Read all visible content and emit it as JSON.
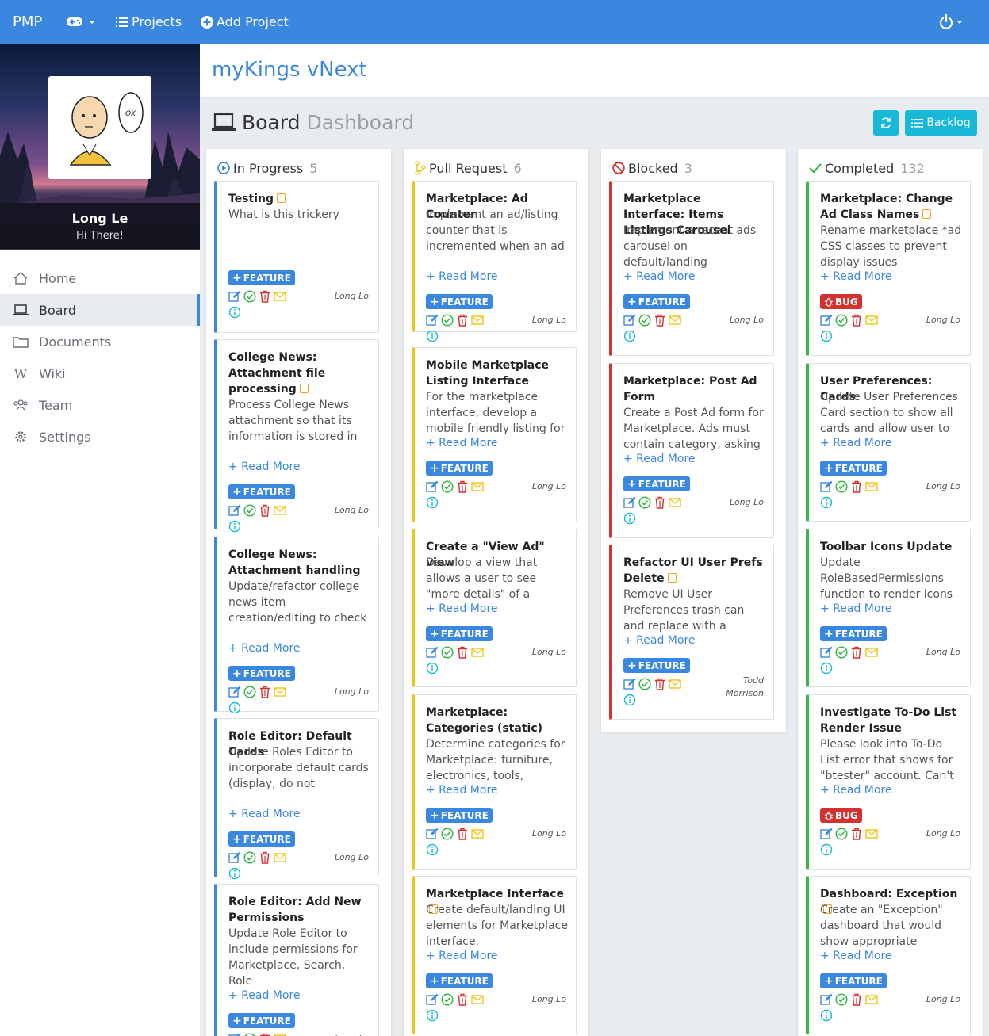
{
  "navbar": {
    "brand": "PMP",
    "projects_label": "Projects",
    "add_project_label": "Add Project"
  },
  "sidebar": {
    "user_name": "Long Le",
    "greeting": "Hi There!",
    "items": [
      {
        "label": "Home",
        "icon": "home-icon"
      },
      {
        "label": "Board",
        "icon": "laptop-icon",
        "active": true
      },
      {
        "label": "Documents",
        "icon": "folder-icon"
      },
      {
        "label": "Wiki",
        "icon": "wikipedia-icon"
      },
      {
        "label": "Team",
        "icon": "users-icon"
      },
      {
        "label": "Settings",
        "icon": "gear-icon"
      }
    ]
  },
  "page": {
    "title": "myKings vNext",
    "board_label": "Board",
    "board_sub": "Dashboard",
    "backlog_label": "Backlog"
  },
  "colors": {
    "primary": "#3a87e0",
    "info": "#17b9d6",
    "in_progress": "#3a87e0",
    "pull_request": "#f0c419",
    "blocked": "#d6302f",
    "completed": "#3bb54a"
  },
  "columns": [
    {
      "title": "In Progress",
      "count": "5",
      "cards": [
        {
          "title": "Testing",
          "desc": "What is this trickery",
          "read_more": "",
          "type": "FEATURE",
          "owner": "Long Lo"
        },
        {
          "title": "College News: Attachment file processing",
          "desc": "Process College News attachment so that its information is stored in",
          "read_more": "+ Read More",
          "type": "FEATURE",
          "owner": "Long Lo"
        },
        {
          "title": "College News: Attachment handling",
          "desc": "Update/refactor college news item creation/editing to check",
          "read_more": "+ Read More",
          "type": "FEATURE",
          "owner": "Long Lo"
        },
        {
          "title": "Role Editor: Default Cards",
          "desc": "Update Roles Editor to incorporate default cards (display, do not",
          "read_more": "+ Read More",
          "type": "FEATURE",
          "owner": "Long Lo"
        },
        {
          "title": "Role Editor: Add New Permissions",
          "desc": "Update Role Editor to include permissions for Marketplace, Search, Role",
          "read_more": "+ Read More",
          "type": "FEATURE",
          "owner": "Long Lo"
        }
      ]
    },
    {
      "title": "Pull Request",
      "count": "6",
      "cards": [
        {
          "title": "Marketplace: Ad Counter",
          "desc": "Implement an ad/listing counter that is incremented when an ad",
          "read_more": "+ Read More",
          "type": "FEATURE",
          "owner": "Long Lo"
        },
        {
          "title": "Mobile Marketplace Listing Interface",
          "desc": "For the marketplace interface, develop a mobile friendly listing for",
          "read_more": "+ Read More",
          "type": "FEATURE",
          "owner": "Long Lo"
        },
        {
          "title": "Create a \"View Ad\" view",
          "desc": "Develop a view that allows a user to see \"more details\" of a",
          "read_more": "+ Read More",
          "type": "FEATURE",
          "owner": "Long Lo"
        },
        {
          "title": "Marketplace: Categories (static)",
          "desc": "Determine categories for Marketplace: furniture, electronics, tools,",
          "read_more": "+ Read More",
          "type": "FEATURE",
          "owner": "Long Lo"
        },
        {
          "title": "Marketplace Interface",
          "desc": "Create default/landing UI elements for Marketplace interface.",
          "read_more": "+ Read More",
          "type": "FEATURE",
          "owner": "Long Lo"
        }
      ]
    },
    {
      "title": "Blocked",
      "count": "3",
      "cards": [
        {
          "title": "Marketplace Interface: Items Listings Carousel",
          "desc": "Implement a recent ads carousel on default/landing",
          "read_more": "+ Read More",
          "type": "FEATURE",
          "owner": "Long Lo"
        },
        {
          "title": "Marketplace: Post Ad Form",
          "desc": "Create a Post Ad form for Marketplace. Ads must contain category, asking",
          "read_more": "+ Read More",
          "type": "FEATURE",
          "owner": "Long Lo"
        },
        {
          "title": "Refactor UI User Prefs Delete",
          "desc": "Remove UI User Preferences trash can and replace with a",
          "read_more": "+ Read More",
          "type": "FEATURE",
          "owner": "Todd Morrison"
        }
      ]
    },
    {
      "title": "Completed",
      "count": "132",
      "cards": [
        {
          "title": "Marketplace: Change Ad Class Names",
          "desc": "Rename marketplace *ad CSS classes to prevent display issues",
          "read_more": "+ Read More",
          "type": "BUG",
          "owner": "Long Lo"
        },
        {
          "title": "User Preferences: Cards",
          "desc": "Update User Preferences Card section to show all cards and allow user to",
          "read_more": "+ Read More",
          "type": "FEATURE",
          "owner": "Long Lo"
        },
        {
          "title": "Toolbar Icons Update",
          "desc": "Update RoleBasedPermissions function to render icons",
          "read_more": "+ Read More",
          "type": "FEATURE",
          "owner": "Long Lo"
        },
        {
          "title": "Investigate To-Do List Render Issue",
          "desc": "Please look into To-Do List error that shows for \"btester\" account. Can't",
          "read_more": "+ Read More",
          "type": "BUG",
          "owner": "Long Lo"
        },
        {
          "title": "Dashboard: Exception",
          "desc": "Create an \"Exception\" dashboard that would show appropriate",
          "read_more": "+ Read More",
          "type": "FEATURE",
          "owner": "Long Lo"
        }
      ]
    }
  ]
}
